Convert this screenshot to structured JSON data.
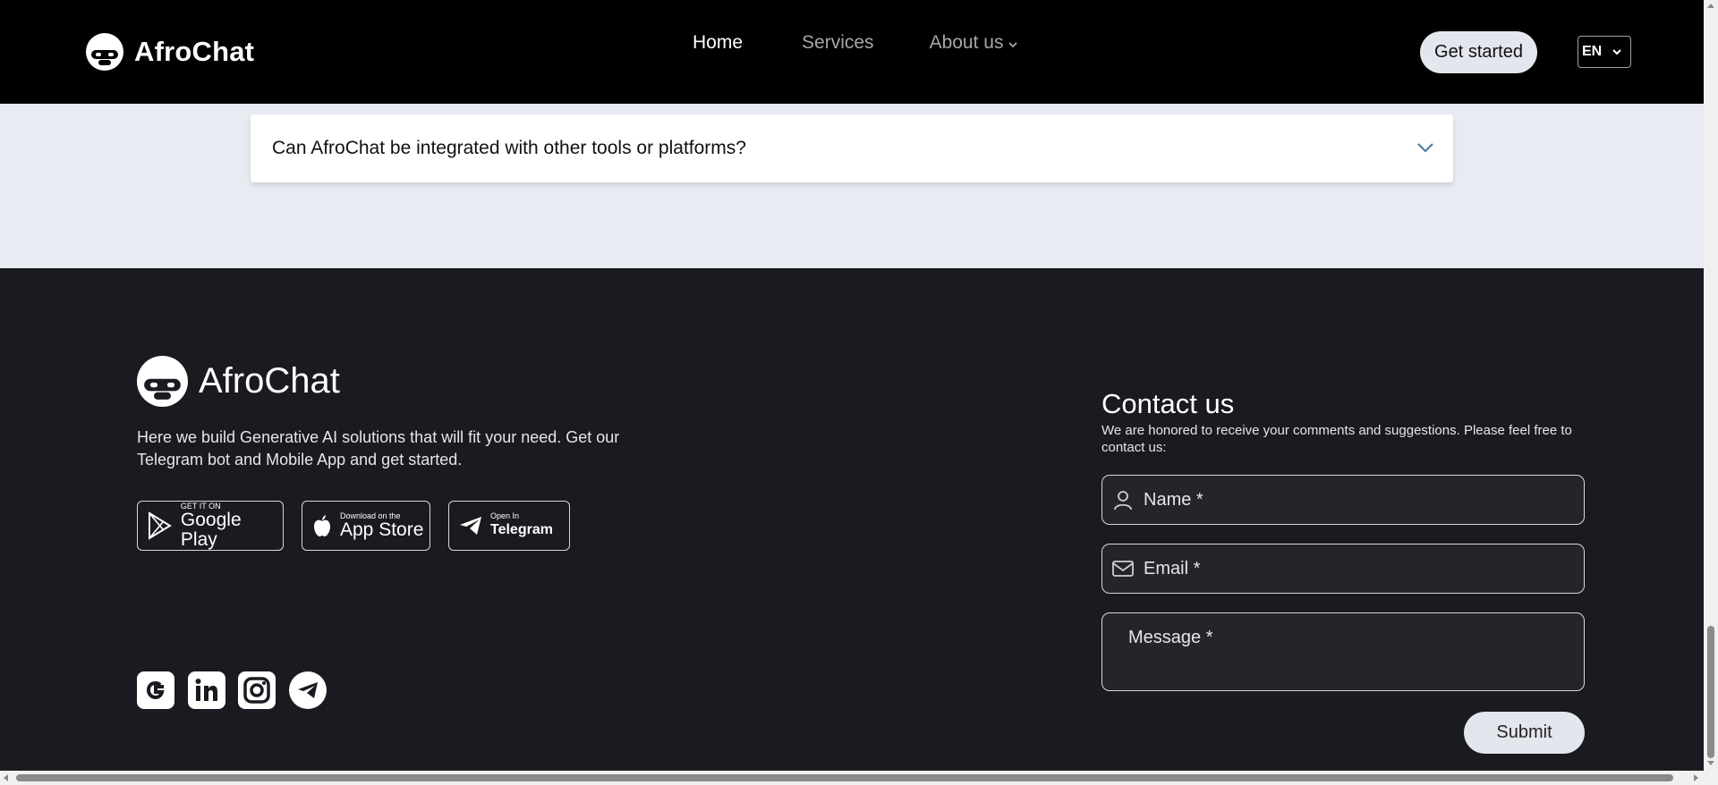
{
  "header": {
    "brand": "AfroChat",
    "nav": [
      {
        "label": "Home"
      },
      {
        "label": "Services"
      },
      {
        "label": "About us"
      }
    ],
    "get_started": "Get started",
    "language": "EN"
  },
  "faq": {
    "question": "Can AfroChat be integrated with other tools or platforms?"
  },
  "footer": {
    "brand": "AfroChat",
    "description": "Here we build Generative AI solutions that will fit your need. Get our Telegram bot and Mobile App and get started.",
    "stores": {
      "google_small": "GET IT ON",
      "google_big": "Google Play",
      "apple_small": "Download on the",
      "apple_big": "App Store",
      "telegram_small": "Open In",
      "telegram_big": "Telegram"
    },
    "social_icons": [
      "google-icon",
      "linkedin-icon",
      "instagram-icon",
      "telegram-icon"
    ]
  },
  "contact": {
    "title": "Contact us",
    "subtitle": "We are honored to receive your comments and suggestions. Please feel free to contact us:",
    "name_placeholder": "Name *",
    "email_placeholder": "Email *",
    "message_placeholder": "Message *",
    "submit": "Submit"
  }
}
